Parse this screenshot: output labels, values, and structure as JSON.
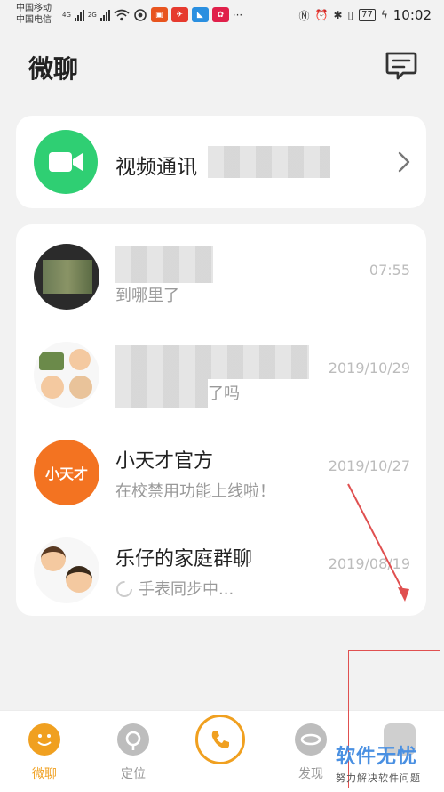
{
  "status_bar": {
    "carrier1": "中国移动",
    "carrier2": "中国电信",
    "net1": "4G",
    "net2": "2G",
    "battery": "77",
    "time": "10:02"
  },
  "header": {
    "title": "微聊"
  },
  "video_call": {
    "label": "视频通讯"
  },
  "chats": [
    {
      "name": "",
      "preview": "到哪里了",
      "date": "07:55"
    },
    {
      "name": "",
      "preview": "了吗",
      "date": "2019/10/29"
    },
    {
      "name": "小天才官方",
      "preview": "在校禁用功能上线啦！",
      "date": "2019/10/27",
      "avatar_text": "小天才"
    },
    {
      "name": "乐仔的家庭群聊",
      "preview": "手表同步中...",
      "date": "2019/08/19"
    }
  ],
  "nav": [
    {
      "label": "微聊",
      "active": true
    },
    {
      "label": "定位"
    },
    {
      "label": ""
    },
    {
      "label": "发现"
    },
    {
      "label": ""
    }
  ],
  "watermark": {
    "title": "软件无忧",
    "subtitle": "努力解决软件问题"
  },
  "colors": {
    "green": "#2fcf73",
    "orange": "#f0a020",
    "brand_orange": "#f37321",
    "annotation_red": "#e05050"
  }
}
